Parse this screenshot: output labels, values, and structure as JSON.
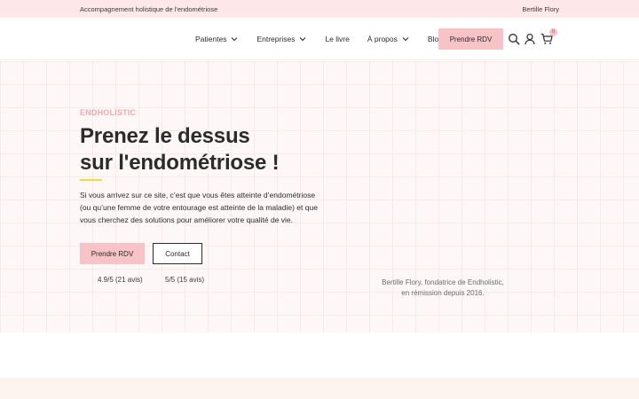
{
  "topbar": {
    "tagline": "Accompagnement holistique de l'endométriose",
    "owner": "Bertille Flory"
  },
  "header": {
    "nav": [
      {
        "label": "Patientes",
        "has_dropdown": true
      },
      {
        "label": "Entreprises",
        "has_dropdown": true
      },
      {
        "label": "Le livre",
        "has_dropdown": false
      },
      {
        "label": "À propos",
        "has_dropdown": true
      },
      {
        "label": "Blog",
        "has_dropdown": false
      }
    ],
    "cta_label": "Prendre RDV",
    "icons": [
      "search-icon",
      "user-icon",
      "cart-icon"
    ],
    "cart_count": "0"
  },
  "hero": {
    "eyebrow": "ENDHOLISTIC",
    "title_line1": "Prenez le dessus",
    "title_line2": "sur l'endométriose !",
    "lead": "Si vous arrivez sur ce site, c’est que vous êtes atteinte d’endométriose (ou qu’une femme de votre entourage est atteinte de la maladie) et que vous cherchez des solutions pour améliorer votre qualité de vie.",
    "primary_button": "Prendre RDV",
    "secondary_button": "Contact",
    "ratings": [
      "4.9/5 (21 avis)",
      "5/5 (15 avis)"
    ],
    "caption_line1": "Bertille Flory, fondatrice de Endholistic,",
    "caption_line2": "en rémission depuis 2016."
  },
  "colors": {
    "topbar_bg": "#fde7e8",
    "cta_pink": "#f7c3c6",
    "eyebrow_pink": "#f3a7ad",
    "accent_yellow": "#f2d64b",
    "text_dark": "#2b2b2b",
    "hero_bg": "#fdf8f7"
  }
}
